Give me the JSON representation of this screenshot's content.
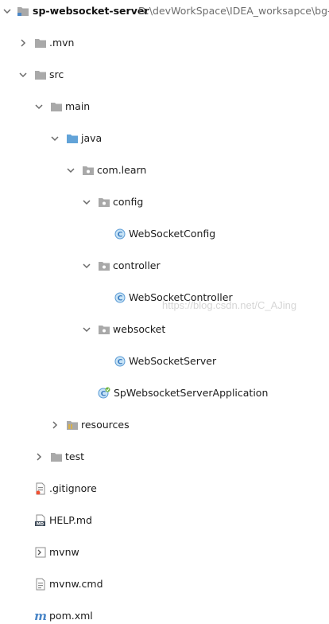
{
  "project_tree": {
    "root": {
      "name": "sp-websocket-server",
      "path": "D:\\devWorkSpace\\IDEA_worksapce\\bg-p"
    },
    "nodes": {
      "mvn": ".mvn",
      "src": "src",
      "main": "main",
      "java": "java",
      "com_learn": "com.learn",
      "config": "config",
      "websocket_config": "WebSocketConfig",
      "controller": "controller",
      "websocket_controller": "WebSocketController",
      "websocket": "websocket",
      "websocket_server": "WebSocketServer",
      "application": "SpWebsocketServerApplication",
      "resources": "resources",
      "test": "test",
      "gitignore": ".gitignore",
      "help_md": "HELP.md",
      "mvnw": "mvnw",
      "mvnw_cmd": "mvnw.cmd",
      "pom_xml": "pom.xml"
    },
    "icon_text": {
      "class": "C",
      "markdown": "MD",
      "maven": "m"
    }
  },
  "watermark": "https://blog.csdn.net/C_AJing",
  "colors": {
    "folder": "#a9a9a9",
    "source_folder": "#62a3d8",
    "resources_stripe": "#d8b04a",
    "class_icon_bg": "#c7e3f6",
    "class_icon_border": "#5b9bd5",
    "class_letter": "#3a7bbf",
    "arrow": "#6a6a6a"
  }
}
